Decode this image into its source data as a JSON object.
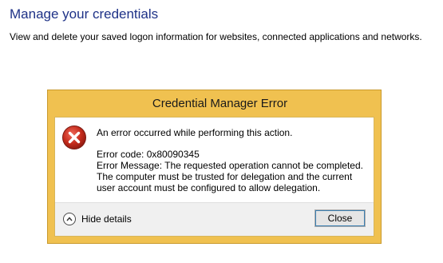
{
  "page": {
    "title": "Manage your credentials",
    "subtitle": "View and delete your saved logon information for websites, connected applications and networks."
  },
  "dialog": {
    "title": "Credential Manager Error",
    "icon": "error-icon",
    "main_instruction": "An error occurred while performing this action.",
    "details": [
      "Error code: 0x80090345",
      "Error Message: The requested operation cannot be completed.",
      "The computer must be trusted for delegation and the current",
      "user account must be configured to allow delegation."
    ],
    "toggle_label": "Hide details",
    "close_label": "Close"
  },
  "colors": {
    "page_title": "#1e3287",
    "dialog_frame": "#f0c150",
    "error_red": "#c42b1c",
    "footer_bg": "#f0f0f0"
  }
}
